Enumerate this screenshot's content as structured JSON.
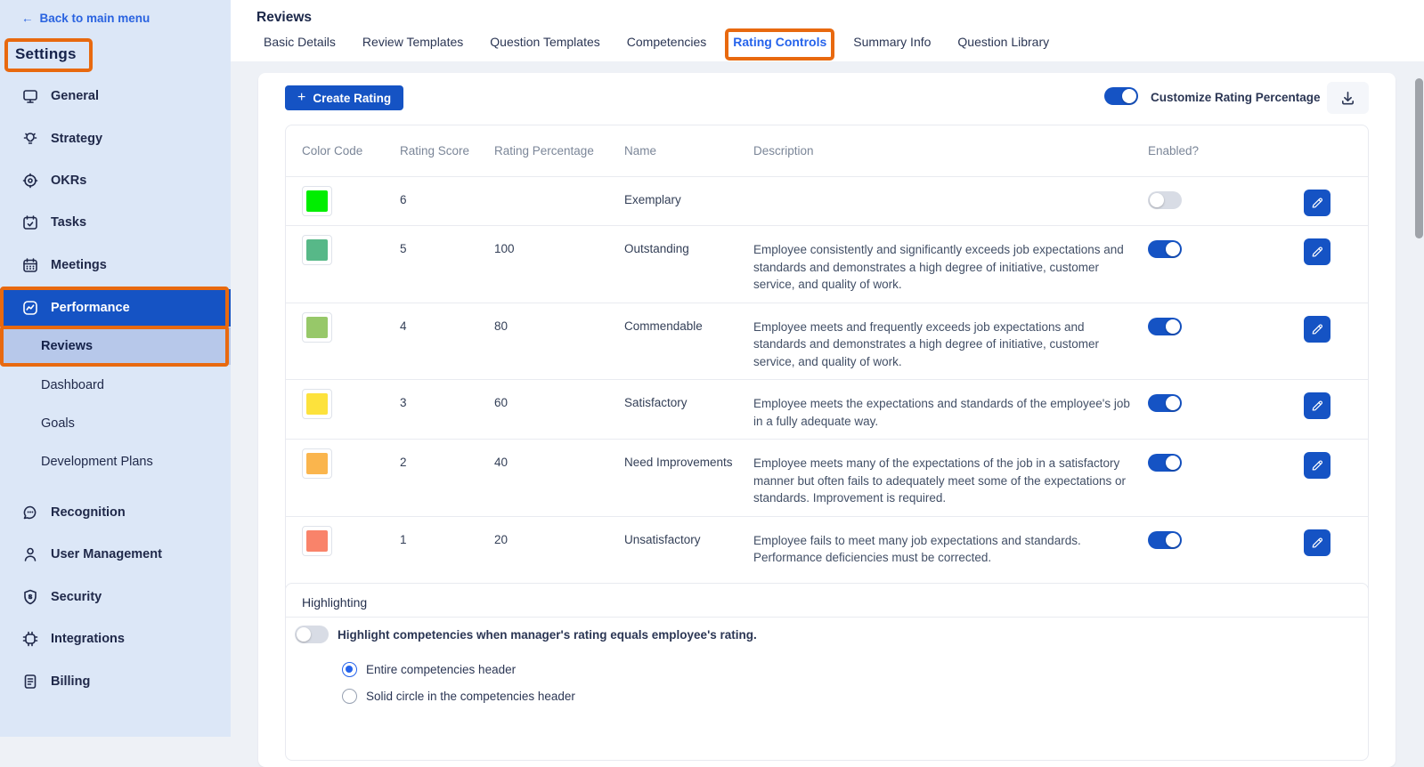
{
  "sidebar": {
    "back_label": "Back to main menu",
    "title": "Settings",
    "items": [
      {
        "label": "General",
        "icon": "monitor-icon"
      },
      {
        "label": "Strategy",
        "icon": "lightbulb-icon"
      },
      {
        "label": "OKRs",
        "icon": "target-icon"
      },
      {
        "label": "Tasks",
        "icon": "calendar-check-icon"
      },
      {
        "label": "Meetings",
        "icon": "calendar-icon"
      },
      {
        "label": "Performance",
        "icon": "chart-icon",
        "active": true
      },
      {
        "label": "Reviews",
        "active": true
      },
      {
        "label": "Dashboard"
      },
      {
        "label": "Goals"
      },
      {
        "label": "Development Plans"
      },
      {
        "label": "Recognition",
        "icon": "chat-icon"
      },
      {
        "label": "User Management",
        "icon": "user-icon"
      },
      {
        "label": "Security",
        "icon": "shield-icon"
      },
      {
        "label": "Integrations",
        "icon": "chip-icon"
      },
      {
        "label": "Billing",
        "icon": "document-icon"
      }
    ]
  },
  "header": {
    "title": "Reviews",
    "tabs": [
      {
        "label": "Basic Details"
      },
      {
        "label": "Review Templates"
      },
      {
        "label": "Question Templates"
      },
      {
        "label": "Competencies"
      },
      {
        "label": "Rating Controls",
        "active": true
      },
      {
        "label": "Summary Info"
      },
      {
        "label": "Question Library"
      }
    ]
  },
  "toolbar": {
    "create_label": "Create Rating",
    "customize_label": "Customize Rating Percentage",
    "customize_on": true
  },
  "table": {
    "columns": [
      "Color Code",
      "Rating Score",
      "Rating Percentage",
      "Name",
      "Description",
      "Enabled?"
    ],
    "rows": [
      {
        "color": "#00ee00",
        "score": "6",
        "percentage": "",
        "name": "Exemplary",
        "description": "",
        "enabled": false
      },
      {
        "color": "#57b888",
        "score": "5",
        "percentage": "100",
        "name": "Outstanding",
        "description": "Employee consistently and significantly exceeds job expectations and standards and demonstrates a high degree of initiative, customer service, and quality of work.",
        "enabled": true
      },
      {
        "color": "#97c869",
        "score": "4",
        "percentage": "80",
        "name": "Commendable",
        "description": "Employee meets and frequently exceeds job expectations and standards and demonstrates a high degree of initiative, customer service, and quality of work.",
        "enabled": true
      },
      {
        "color": "#fde23c",
        "score": "3",
        "percentage": "60",
        "name": "Satisfactory",
        "description": "Employee meets the expectations and standards of the employee's job in a fully adequate way.",
        "enabled": true
      },
      {
        "color": "#fab54d",
        "score": "2",
        "percentage": "40",
        "name": "Need Improvements",
        "description": "Employee meets many of the expectations of the job in a satisfactory manner but often fails to adequately meet some of the expectations or standards. Improvement is required.",
        "enabled": true
      },
      {
        "color": "#f9836a",
        "score": "1",
        "percentage": "20",
        "name": "Unsatisfactory",
        "description": "Employee fails to meet many job expectations and standards. Performance deficiencies must be corrected.",
        "enabled": true
      }
    ]
  },
  "highlighting": {
    "title": "Highlighting",
    "toggle_label": "Highlight competencies when manager's rating equals employee's rating.",
    "toggle_on": false,
    "options": [
      {
        "label": "Entire competencies header",
        "selected": true
      },
      {
        "label": "Solid circle in the competencies header",
        "selected": false
      }
    ]
  },
  "colors": {
    "primary_blue": "#1553c4",
    "tab_active_blue": "#2563eb",
    "annotation_orange": "#e8690f",
    "sidebar_bg": "#dce7f7",
    "active_sub_bg": "#b7c8ea"
  }
}
